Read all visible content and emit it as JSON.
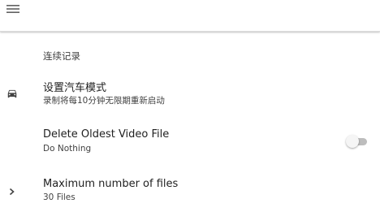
{
  "toolbar": {
    "menu_icon": "hamburger-menu-icon"
  },
  "section": {
    "header": "连续记录"
  },
  "preferences": [
    {
      "title": "设置汽车模式",
      "summary": "录制将每10分钟无限期重新启动",
      "icon": "car-icon"
    },
    {
      "title": "Delete Oldest Video File",
      "summary": "Do Nothing",
      "toggle_on": false
    },
    {
      "title": "Maximum number of files",
      "summary": "30 Files",
      "icon": "chevron-right-icon"
    }
  ],
  "colors": {
    "toolbar_bg": "#ffffff",
    "text_primary": "#212121",
    "text_secondary": "#424242",
    "toggle_track_off": "#bdbdbd",
    "toggle_thumb_off": "#f5f5f5"
  }
}
